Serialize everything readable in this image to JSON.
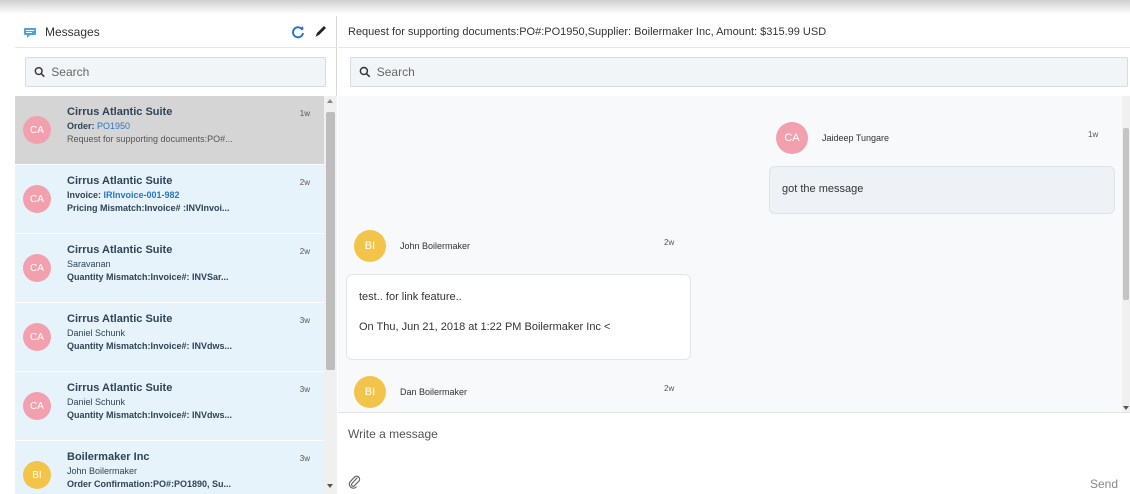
{
  "sidebar": {
    "title": "Messages",
    "search_placeholder": "Search",
    "items": [
      {
        "avatar": "CA",
        "name": "Cirrus Atlantic Suite",
        "sub_label": "Order: ",
        "sub_value": "PO1950",
        "preview": "Request for supporting documents:PO#...",
        "time": "1w"
      },
      {
        "avatar": "CA",
        "name": "Cirrus Atlantic Suite",
        "sub_label": "Invoice: ",
        "sub_value": "IRInvoice-001-982",
        "preview": "Pricing Mismatch:Invoice# :INVInvoi...",
        "time": "2w"
      },
      {
        "avatar": "CA",
        "name": "Cirrus Atlantic Suite",
        "sub_text": "Saravanan",
        "preview": "Quantity Mismatch:Invoice#: INVSar...",
        "time": "2w"
      },
      {
        "avatar": "CA",
        "name": "Cirrus Atlantic Suite",
        "sub_text": "Daniel Schunk",
        "preview": "Quantity Mismatch:Invoice#: INVdws...",
        "time": "3w"
      },
      {
        "avatar": "CA",
        "name": "Cirrus Atlantic Suite",
        "sub_text": "Daniel Schunk",
        "preview": "Quantity Mismatch:Invoice#: INVdws...",
        "time": "3w"
      },
      {
        "avatar": "BI",
        "name": "Boilermaker Inc",
        "sub_text": "John Boilermaker",
        "preview": "Order Confirmation:PO#:PO1890, Su...",
        "time": "3w"
      }
    ]
  },
  "conversation": {
    "subject": "Request for supporting documents:PO#:PO1950,Supplier: Boilermaker Inc, Amount: $315.99 USD",
    "search_placeholder": "Search",
    "messages": [
      {
        "avatar": "CA",
        "author": "Jaideep Tungare",
        "time": "1w",
        "text": "got the message"
      },
      {
        "avatar": "BI",
        "author": "John Boilermaker",
        "time": "2w",
        "line1": "test.. for link feature..",
        "line2": "On Thu, Jun 21, 2018 at 1:22 PM Boilermaker Inc <"
      },
      {
        "avatar": "BI",
        "author": "Dan Boilermaker",
        "time": "2w"
      }
    ],
    "composer_placeholder": "Write a message",
    "send_label": "Send"
  },
  "colors": {
    "avatar_pink": "#f2a0ae",
    "avatar_yellow": "#f2c44a",
    "list_bg": "#e7f3fb",
    "selected_bg": "#d5d5d5",
    "link_blue": "#2a76c6",
    "refresh_blue": "#2a76c6"
  },
  "icons": {
    "header": "chat-bubble-icon",
    "refresh": "refresh-icon",
    "compose": "pencil-icon",
    "search": "search-icon",
    "attach": "paperclip-icon"
  }
}
